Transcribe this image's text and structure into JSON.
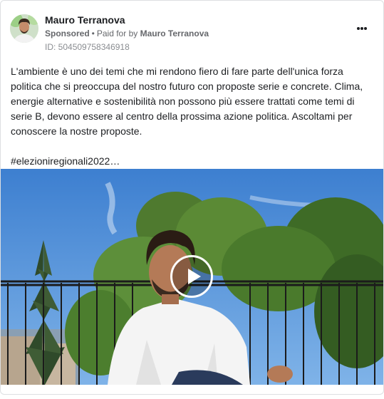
{
  "post": {
    "author": "Mauro Terranova",
    "sponsored": "Sponsored",
    "separator": "•",
    "paid_for_prefix": "Paid for by",
    "paid_for_name": "Mauro Terranova",
    "id_label": "ID: 504509758346918",
    "body": "L'ambiente è uno dei temi che mi rendono fiero di fare parte dell'unica forza politica che si preoccupa del nostro futuro con proposte serie e concrete. Clima, energie alternative e sostenibilità non possono più essere trattati come temi di serie B, devono essere al centro della prossima azione politica. Ascoltami per conoscere la nostre proposte.",
    "hashtag": "#elezioniregionali2022…"
  },
  "icons": {
    "more": "more-horizontal-icon",
    "play": "play-icon"
  },
  "colors": {
    "name": "#1c1e21",
    "secondary": "#65676b",
    "sky": "#4a8ad6"
  }
}
